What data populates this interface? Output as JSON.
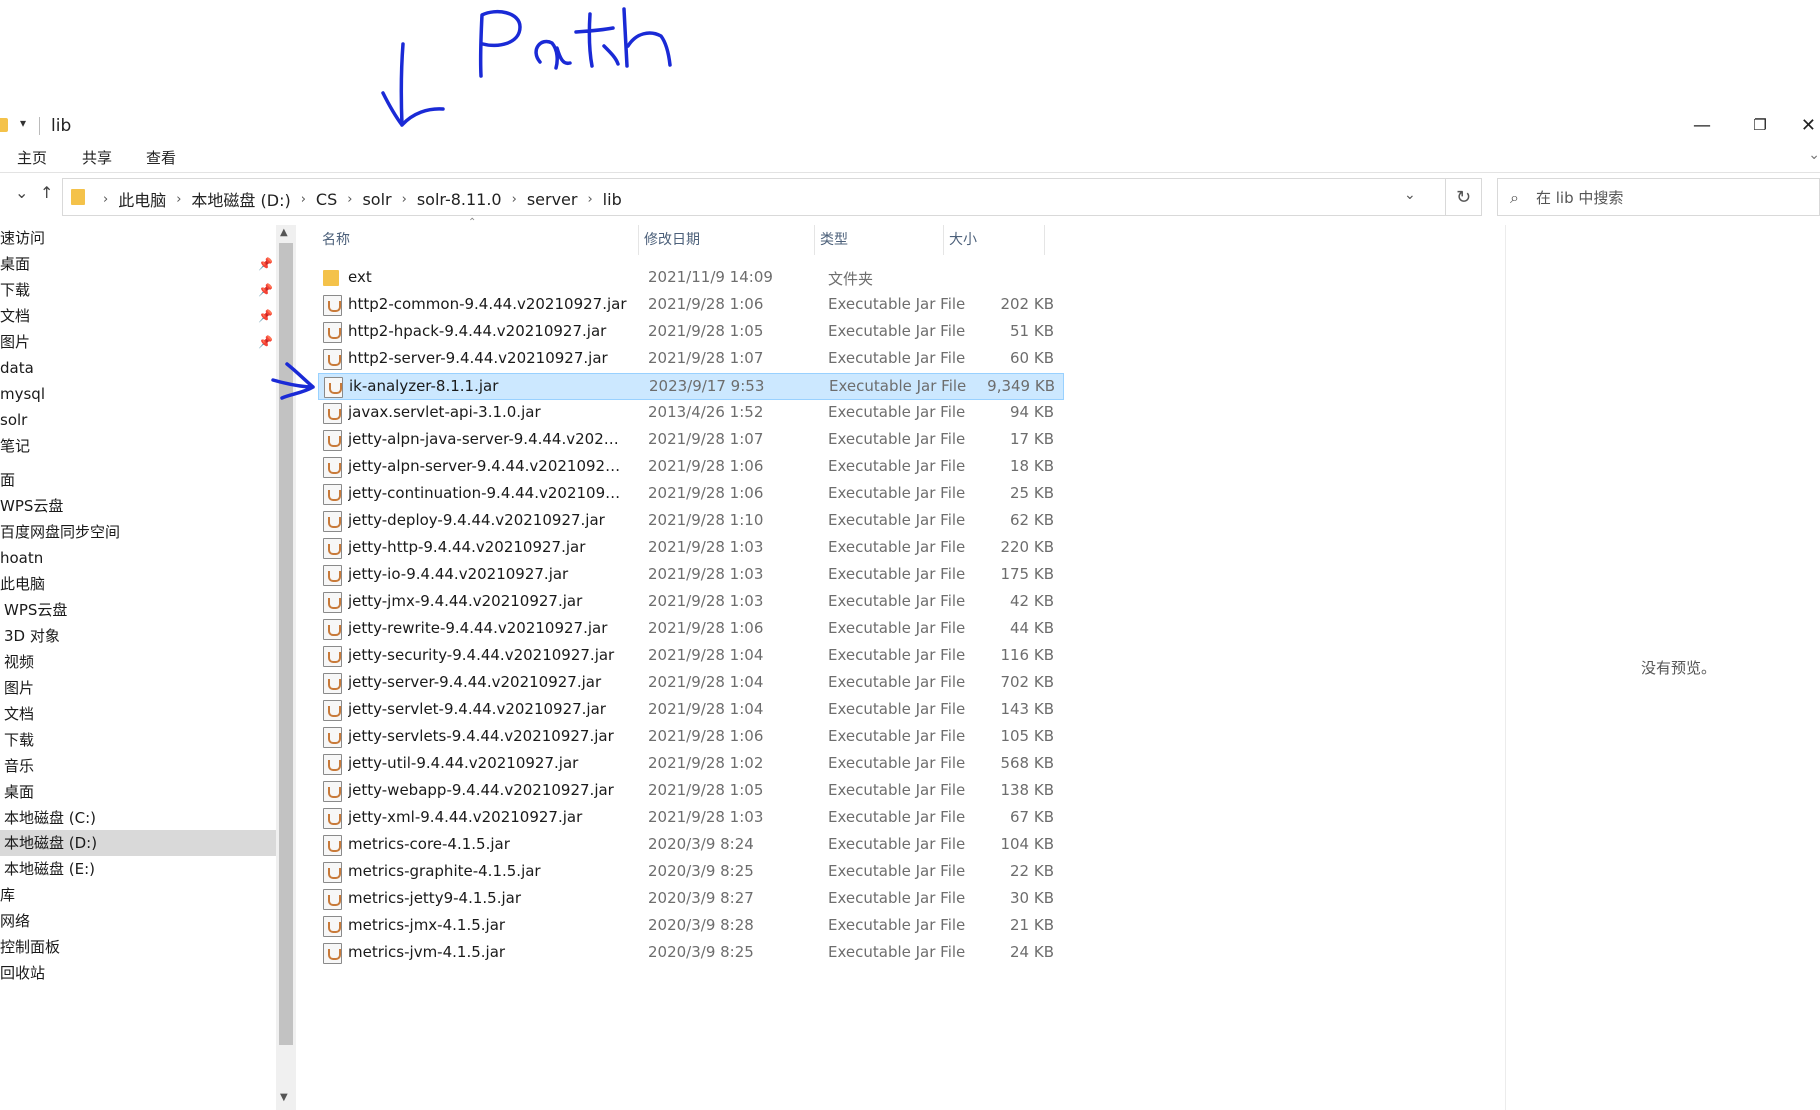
{
  "annotation": {
    "text": "Path"
  },
  "window": {
    "title": "lib",
    "quick_access_glyph": "▾",
    "minimize_glyph": "—",
    "restore_glyph": "❐",
    "close_glyph": "✕"
  },
  "ribbon": {
    "tabs": [
      "主页",
      "共享",
      "查看"
    ],
    "expand_glyph": "⌄"
  },
  "nav": {
    "back_glyph": "⌄",
    "up_glyph": "↑"
  },
  "address": {
    "crumbs": [
      "此电脑",
      "本地磁盘 (D:)",
      "CS",
      "solr",
      "solr-8.11.0",
      "server",
      "lib"
    ],
    "separator": "›",
    "dropdown_glyph": "⌄",
    "refresh_glyph": "↻"
  },
  "search": {
    "placeholder": "在 lib 中搜索",
    "icon": "⌕"
  },
  "sidebar": {
    "items": [
      {
        "label": "速访问",
        "pinned": false
      },
      {
        "label": "桌面",
        "pinned": true
      },
      {
        "label": "下载",
        "pinned": true
      },
      {
        "label": "文档",
        "pinned": true
      },
      {
        "label": "图片",
        "pinned": true
      },
      {
        "label": "data",
        "pinned": false
      },
      {
        "label": "mysql",
        "pinned": false
      },
      {
        "label": "solr",
        "pinned": false
      },
      {
        "label": "笔记",
        "pinned": false
      },
      {
        "label": "面",
        "pinned": false
      },
      {
        "label": "WPS云盘",
        "pinned": false
      },
      {
        "label": "百度网盘同步空间",
        "pinned": false
      },
      {
        "label": "hoatn",
        "pinned": false
      },
      {
        "label": "此电脑",
        "pinned": false
      },
      {
        "label": "WPS云盘",
        "pinned": false
      },
      {
        "label": "3D 对象",
        "pinned": false
      },
      {
        "label": "视频",
        "pinned": false
      },
      {
        "label": "图片",
        "pinned": false
      },
      {
        "label": "文档",
        "pinned": false
      },
      {
        "label": "下载",
        "pinned": false
      },
      {
        "label": "音乐",
        "pinned": false
      },
      {
        "label": "桌面",
        "pinned": false
      },
      {
        "label": "本地磁盘 (C:)",
        "pinned": false
      },
      {
        "label": "本地磁盘 (D:)",
        "pinned": false,
        "selected": true
      },
      {
        "label": "本地磁盘 (E:)",
        "pinned": false
      },
      {
        "label": "库",
        "pinned": false
      },
      {
        "label": "网络",
        "pinned": false
      },
      {
        "label": "控制面板",
        "pinned": false
      },
      {
        "label": "回收站",
        "pinned": false
      }
    ],
    "pin_glyph": "📌"
  },
  "scroll": {
    "up_glyph": "▲",
    "down_glyph": "▼"
  },
  "columns": {
    "name": "名称",
    "date": "修改日期",
    "type": "类型",
    "size": "大小",
    "sort_glyph": "⌃"
  },
  "files": [
    {
      "name": "ext",
      "date": "2021/11/9 14:09",
      "type": "文件夹",
      "size": "",
      "kind": "folder"
    },
    {
      "name": "http2-common-9.4.44.v20210927.jar",
      "date": "2021/9/28 1:06",
      "type": "Executable Jar File",
      "size": "202 KB",
      "kind": "jar"
    },
    {
      "name": "http2-hpack-9.4.44.v20210927.jar",
      "date": "2021/9/28 1:05",
      "type": "Executable Jar File",
      "size": "51 KB",
      "kind": "jar"
    },
    {
      "name": "http2-server-9.4.44.v20210927.jar",
      "date": "2021/9/28 1:07",
      "type": "Executable Jar File",
      "size": "60 KB",
      "kind": "jar"
    },
    {
      "name": "ik-analyzer-8.1.1.jar",
      "date": "2023/9/17 9:53",
      "type": "Executable Jar File",
      "size": "9,349 KB",
      "kind": "jar",
      "selected": true
    },
    {
      "name": "javax.servlet-api-3.1.0.jar",
      "date": "2013/4/26 1:52",
      "type": "Executable Jar File",
      "size": "94 KB",
      "kind": "jar"
    },
    {
      "name": "jetty-alpn-java-server-9.4.44.v20210...",
      "date": "2021/9/28 1:07",
      "type": "Executable Jar File",
      "size": "17 KB",
      "kind": "jar"
    },
    {
      "name": "jetty-alpn-server-9.4.44.v20210927.jar",
      "date": "2021/9/28 1:06",
      "type": "Executable Jar File",
      "size": "18 KB",
      "kind": "jar"
    },
    {
      "name": "jetty-continuation-9.4.44.v20210927....",
      "date": "2021/9/28 1:06",
      "type": "Executable Jar File",
      "size": "25 KB",
      "kind": "jar"
    },
    {
      "name": "jetty-deploy-9.4.44.v20210927.jar",
      "date": "2021/9/28 1:10",
      "type": "Executable Jar File",
      "size": "62 KB",
      "kind": "jar"
    },
    {
      "name": "jetty-http-9.4.44.v20210927.jar",
      "date": "2021/9/28 1:03",
      "type": "Executable Jar File",
      "size": "220 KB",
      "kind": "jar"
    },
    {
      "name": "jetty-io-9.4.44.v20210927.jar",
      "date": "2021/9/28 1:03",
      "type": "Executable Jar File",
      "size": "175 KB",
      "kind": "jar"
    },
    {
      "name": "jetty-jmx-9.4.44.v20210927.jar",
      "date": "2021/9/28 1:03",
      "type": "Executable Jar File",
      "size": "42 KB",
      "kind": "jar"
    },
    {
      "name": "jetty-rewrite-9.4.44.v20210927.jar",
      "date": "2021/9/28 1:06",
      "type": "Executable Jar File",
      "size": "44 KB",
      "kind": "jar"
    },
    {
      "name": "jetty-security-9.4.44.v20210927.jar",
      "date": "2021/9/28 1:04",
      "type": "Executable Jar File",
      "size": "116 KB",
      "kind": "jar"
    },
    {
      "name": "jetty-server-9.4.44.v20210927.jar",
      "date": "2021/9/28 1:04",
      "type": "Executable Jar File",
      "size": "702 KB",
      "kind": "jar"
    },
    {
      "name": "jetty-servlet-9.4.44.v20210927.jar",
      "date": "2021/9/28 1:04",
      "type": "Executable Jar File",
      "size": "143 KB",
      "kind": "jar"
    },
    {
      "name": "jetty-servlets-9.4.44.v20210927.jar",
      "date": "2021/9/28 1:06",
      "type": "Executable Jar File",
      "size": "105 KB",
      "kind": "jar"
    },
    {
      "name": "jetty-util-9.4.44.v20210927.jar",
      "date": "2021/9/28 1:02",
      "type": "Executable Jar File",
      "size": "568 KB",
      "kind": "jar"
    },
    {
      "name": "jetty-webapp-9.4.44.v20210927.jar",
      "date": "2021/9/28 1:05",
      "type": "Executable Jar File",
      "size": "138 KB",
      "kind": "jar"
    },
    {
      "name": "jetty-xml-9.4.44.v20210927.jar",
      "date": "2021/9/28 1:03",
      "type": "Executable Jar File",
      "size": "67 KB",
      "kind": "jar"
    },
    {
      "name": "metrics-core-4.1.5.jar",
      "date": "2020/3/9 8:24",
      "type": "Executable Jar File",
      "size": "104 KB",
      "kind": "jar"
    },
    {
      "name": "metrics-graphite-4.1.5.jar",
      "date": "2020/3/9 8:25",
      "type": "Executable Jar File",
      "size": "22 KB",
      "kind": "jar"
    },
    {
      "name": "metrics-jetty9-4.1.5.jar",
      "date": "2020/3/9 8:27",
      "type": "Executable Jar File",
      "size": "30 KB",
      "kind": "jar"
    },
    {
      "name": "metrics-jmx-4.1.5.jar",
      "date": "2020/3/9 8:28",
      "type": "Executable Jar File",
      "size": "21 KB",
      "kind": "jar"
    },
    {
      "name": "metrics-jvm-4.1.5.jar",
      "date": "2020/3/9 8:25",
      "type": "Executable Jar File",
      "size": "24 KB",
      "kind": "jar"
    }
  ],
  "preview": {
    "text": "没有预览。"
  },
  "colors": {
    "selection": "#cce8ff",
    "selection_border": "#99d1ff",
    "annotation_ink": "#1a2ad6",
    "folder": "#f4c24a"
  }
}
